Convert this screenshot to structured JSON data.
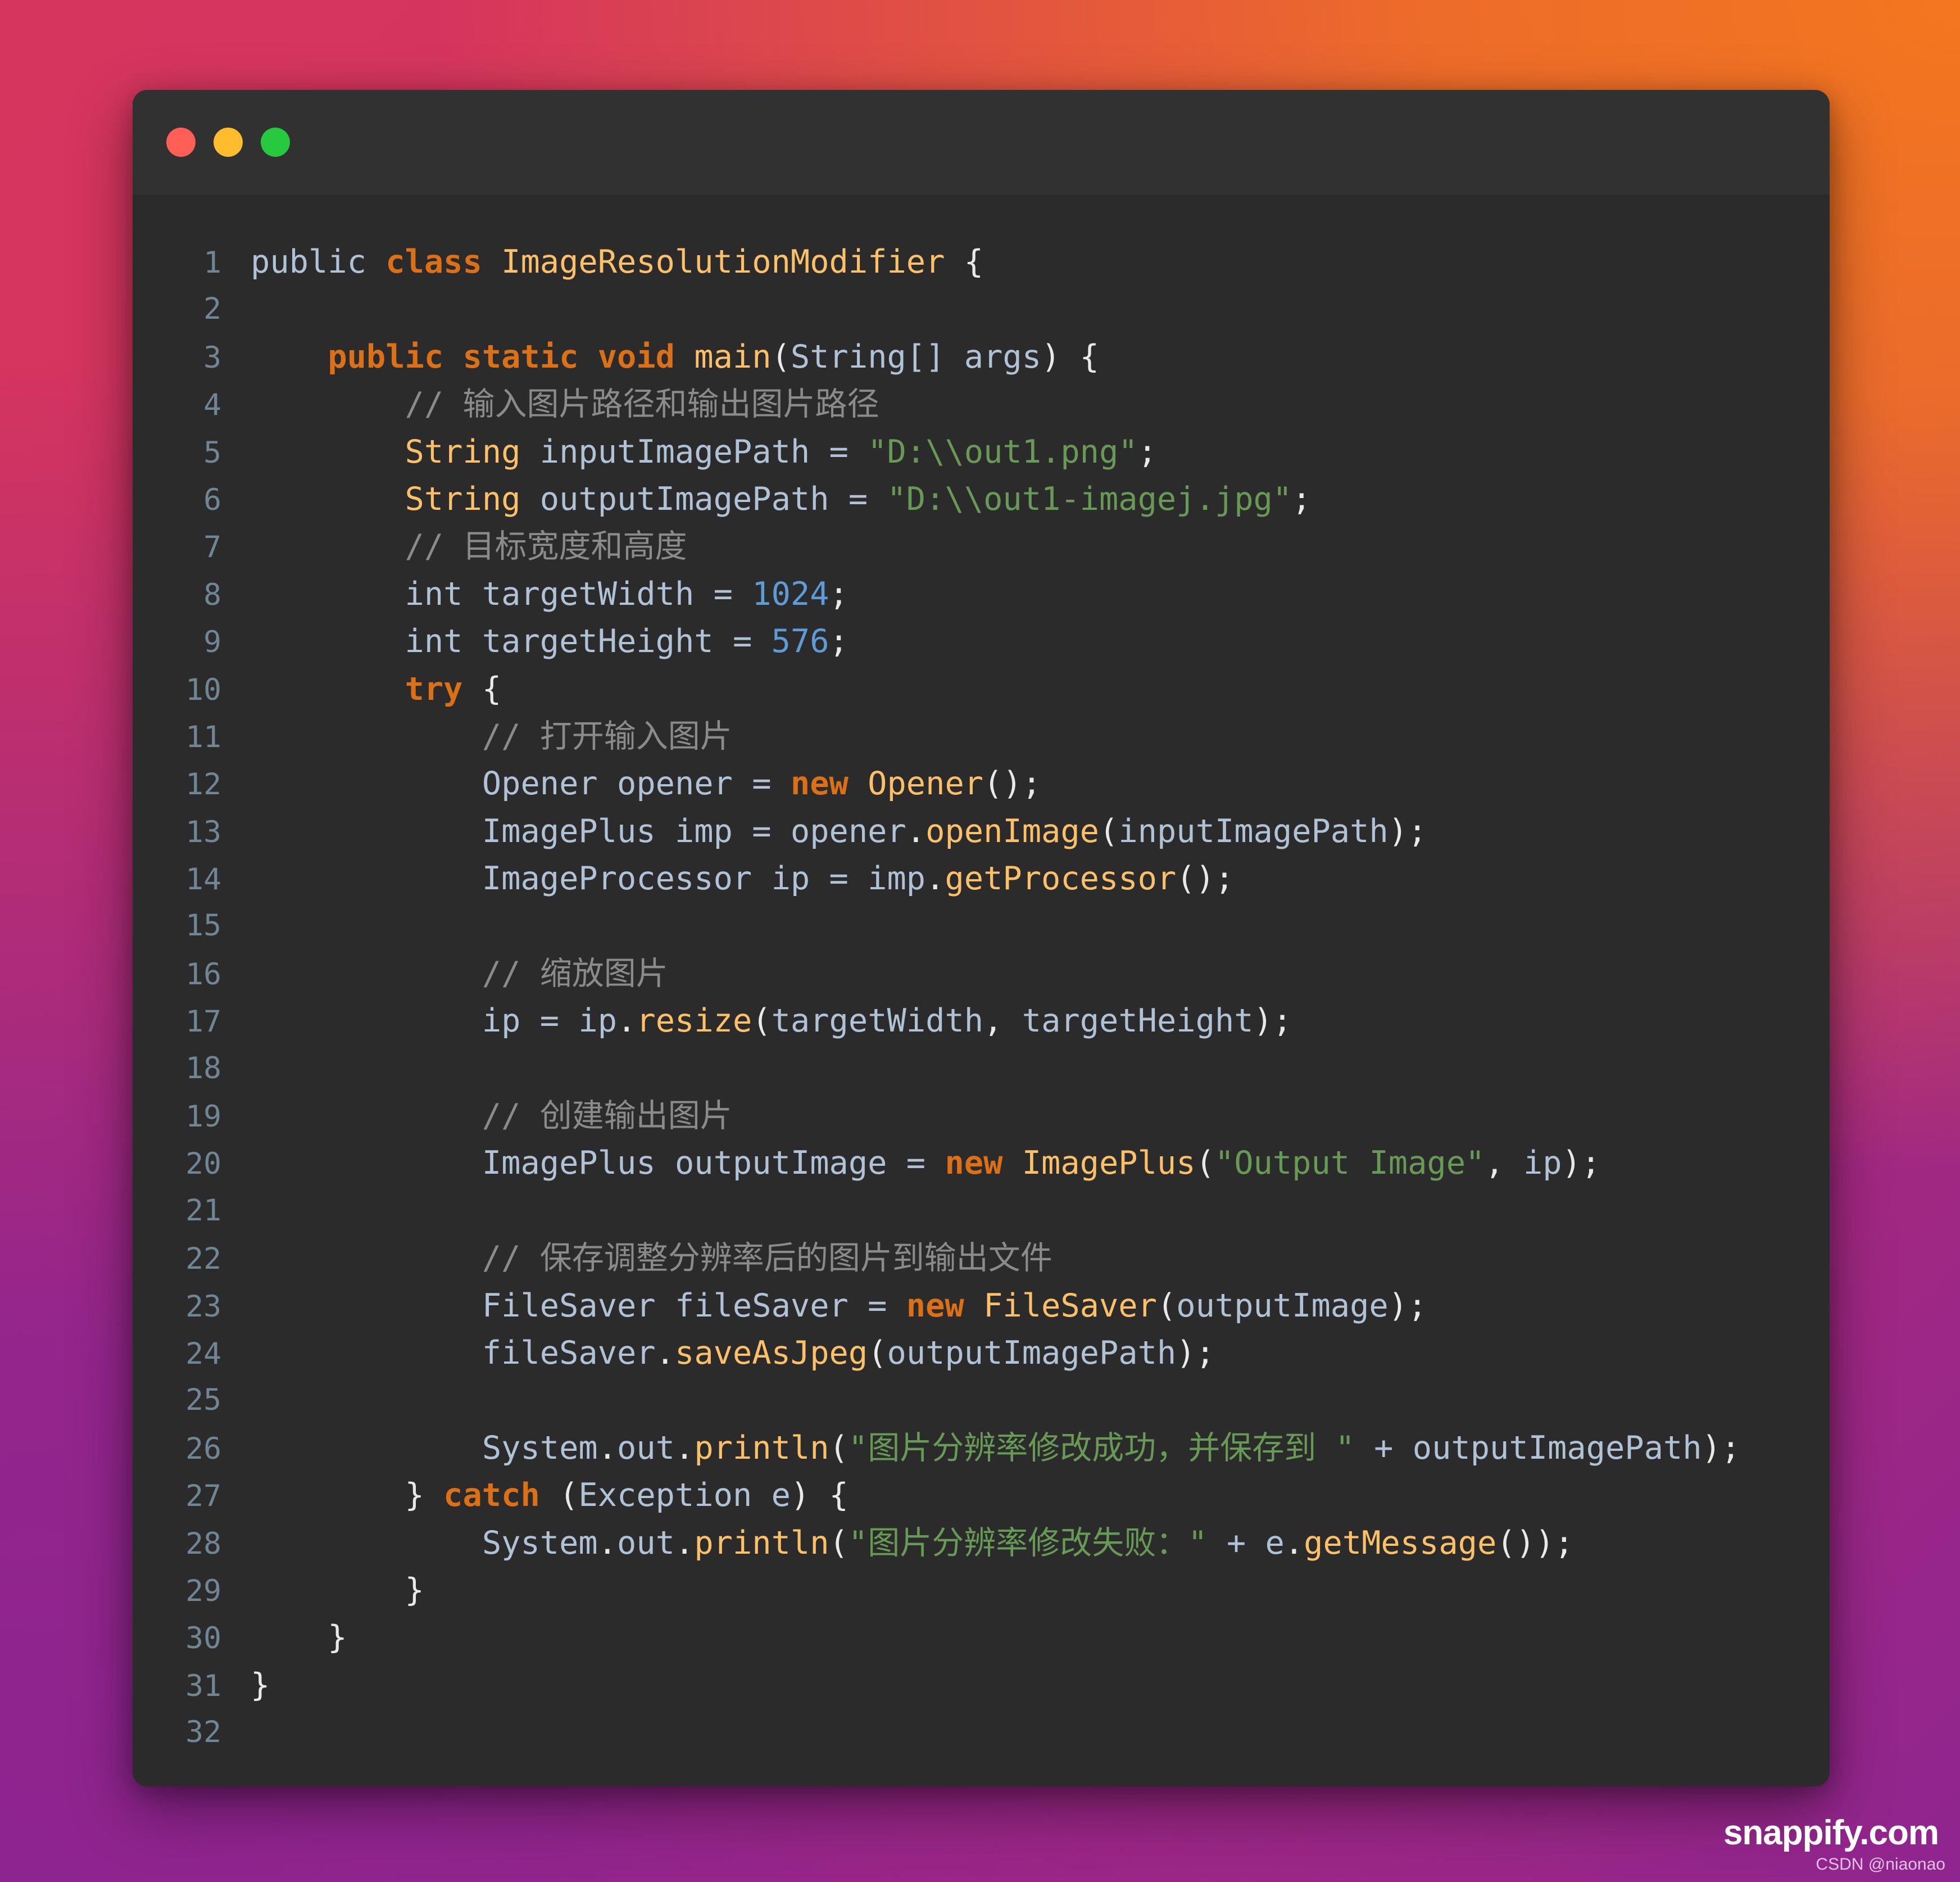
{
  "window": {
    "traffic_lights": [
      {
        "name": "close",
        "color": "#ff5f56"
      },
      {
        "name": "minimize",
        "color": "#ffbd2e"
      },
      {
        "name": "maximize",
        "color": "#27c93f"
      }
    ]
  },
  "editor": {
    "language": "java",
    "first_line_number": 1,
    "last_line_number": 32,
    "theme": {
      "background": "#2b2b2b",
      "titlebar": "#313131",
      "keyword": "#dc7017",
      "type": "#fcc069",
      "method": "#fcc069",
      "identifier": "#afc2d6",
      "string": "#669a55",
      "number": "#5e9cd8",
      "comment": "#8b8b8b",
      "punctuation": "#e9e9e9",
      "line_number": "#6f8694"
    },
    "lines": [
      {
        "n": 1,
        "tokens": [
          {
            "t": "public ",
            "c": "id"
          },
          {
            "t": "class ",
            "c": "kw"
          },
          {
            "t": "ImageResolutionModifier",
            "c": "typ"
          },
          {
            "t": " {",
            "c": "pun"
          }
        ]
      },
      {
        "n": 2,
        "tokens": []
      },
      {
        "n": 3,
        "tokens": [
          {
            "t": "    ",
            "c": "pun"
          },
          {
            "t": "public static void ",
            "c": "kw"
          },
          {
            "t": "main",
            "c": "typ"
          },
          {
            "t": "(",
            "c": "pun"
          },
          {
            "t": "String[] args",
            "c": "id"
          },
          {
            "t": ") {",
            "c": "pun"
          }
        ]
      },
      {
        "n": 4,
        "tokens": [
          {
            "t": "        // 输入图片路径和输出图片路径",
            "c": "cmt"
          }
        ]
      },
      {
        "n": 5,
        "tokens": [
          {
            "t": "        ",
            "c": "pun"
          },
          {
            "t": "String",
            "c": "typ"
          },
          {
            "t": " inputImagePath ",
            "c": "id"
          },
          {
            "t": "= ",
            "c": "id"
          },
          {
            "t": "\"D:\\\\out1.png\"",
            "c": "str"
          },
          {
            "t": ";",
            "c": "pun"
          }
        ]
      },
      {
        "n": 6,
        "tokens": [
          {
            "t": "        ",
            "c": "pun"
          },
          {
            "t": "String",
            "c": "typ"
          },
          {
            "t": " outputImagePath ",
            "c": "id"
          },
          {
            "t": "= ",
            "c": "id"
          },
          {
            "t": "\"D:\\\\out1-imagej.jpg\"",
            "c": "str"
          },
          {
            "t": ";",
            "c": "pun"
          }
        ]
      },
      {
        "n": 7,
        "tokens": [
          {
            "t": "        // 目标宽度和高度",
            "c": "cmt"
          }
        ]
      },
      {
        "n": 8,
        "tokens": [
          {
            "t": "        ",
            "c": "pun"
          },
          {
            "t": "int targetWidth ",
            "c": "id"
          },
          {
            "t": "= ",
            "c": "id"
          },
          {
            "t": "1024",
            "c": "num"
          },
          {
            "t": ";",
            "c": "pun"
          }
        ]
      },
      {
        "n": 9,
        "tokens": [
          {
            "t": "        ",
            "c": "pun"
          },
          {
            "t": "int targetHeight ",
            "c": "id"
          },
          {
            "t": "= ",
            "c": "id"
          },
          {
            "t": "576",
            "c": "num"
          },
          {
            "t": ";",
            "c": "pun"
          }
        ]
      },
      {
        "n": 10,
        "tokens": [
          {
            "t": "        ",
            "c": "pun"
          },
          {
            "t": "try",
            "c": "kw"
          },
          {
            "t": " {",
            "c": "pun"
          }
        ]
      },
      {
        "n": 11,
        "tokens": [
          {
            "t": "            // 打开输入图片",
            "c": "cmt"
          }
        ]
      },
      {
        "n": 12,
        "tokens": [
          {
            "t": "            ",
            "c": "pun"
          },
          {
            "t": "Opener opener ",
            "c": "id"
          },
          {
            "t": "= ",
            "c": "id"
          },
          {
            "t": "new ",
            "c": "kw"
          },
          {
            "t": "Opener",
            "c": "typ"
          },
          {
            "t": "();",
            "c": "pun"
          }
        ]
      },
      {
        "n": 13,
        "tokens": [
          {
            "t": "            ",
            "c": "pun"
          },
          {
            "t": "ImagePlus imp ",
            "c": "id"
          },
          {
            "t": "= ",
            "c": "id"
          },
          {
            "t": "opener",
            "c": "id"
          },
          {
            "t": ".",
            "c": "pun"
          },
          {
            "t": "openImage",
            "c": "mth"
          },
          {
            "t": "(",
            "c": "pun"
          },
          {
            "t": "inputImagePath",
            "c": "id"
          },
          {
            "t": ");",
            "c": "pun"
          }
        ]
      },
      {
        "n": 14,
        "tokens": [
          {
            "t": "            ",
            "c": "pun"
          },
          {
            "t": "ImageProcessor ip ",
            "c": "id"
          },
          {
            "t": "= ",
            "c": "id"
          },
          {
            "t": "imp",
            "c": "id"
          },
          {
            "t": ".",
            "c": "pun"
          },
          {
            "t": "getProcessor",
            "c": "mth"
          },
          {
            "t": "();",
            "c": "pun"
          }
        ]
      },
      {
        "n": 15,
        "tokens": []
      },
      {
        "n": 16,
        "tokens": [
          {
            "t": "            // 缩放图片",
            "c": "cmt"
          }
        ]
      },
      {
        "n": 17,
        "tokens": [
          {
            "t": "            ",
            "c": "pun"
          },
          {
            "t": "ip ",
            "c": "id"
          },
          {
            "t": "= ",
            "c": "id"
          },
          {
            "t": "ip",
            "c": "id"
          },
          {
            "t": ".",
            "c": "pun"
          },
          {
            "t": "resize",
            "c": "mth"
          },
          {
            "t": "(",
            "c": "pun"
          },
          {
            "t": "targetWidth",
            "c": "id"
          },
          {
            "t": ", ",
            "c": "pun"
          },
          {
            "t": "targetHeight",
            "c": "id"
          },
          {
            "t": ");",
            "c": "pun"
          }
        ]
      },
      {
        "n": 18,
        "tokens": []
      },
      {
        "n": 19,
        "tokens": [
          {
            "t": "            // 创建输出图片",
            "c": "cmt"
          }
        ]
      },
      {
        "n": 20,
        "tokens": [
          {
            "t": "            ",
            "c": "pun"
          },
          {
            "t": "ImagePlus outputImage ",
            "c": "id"
          },
          {
            "t": "= ",
            "c": "id"
          },
          {
            "t": "new ",
            "c": "kw"
          },
          {
            "t": "ImagePlus",
            "c": "typ"
          },
          {
            "t": "(",
            "c": "pun"
          },
          {
            "t": "\"Output Image\"",
            "c": "str"
          },
          {
            "t": ", ",
            "c": "pun"
          },
          {
            "t": "ip",
            "c": "id"
          },
          {
            "t": ");",
            "c": "pun"
          }
        ]
      },
      {
        "n": 21,
        "tokens": []
      },
      {
        "n": 22,
        "tokens": [
          {
            "t": "            // 保存调整分辨率后的图片到输出文件",
            "c": "cmt"
          }
        ]
      },
      {
        "n": 23,
        "tokens": [
          {
            "t": "            ",
            "c": "pun"
          },
          {
            "t": "FileSaver fileSaver ",
            "c": "id"
          },
          {
            "t": "= ",
            "c": "id"
          },
          {
            "t": "new ",
            "c": "kw"
          },
          {
            "t": "FileSaver",
            "c": "typ"
          },
          {
            "t": "(",
            "c": "pun"
          },
          {
            "t": "outputImage",
            "c": "id"
          },
          {
            "t": ");",
            "c": "pun"
          }
        ]
      },
      {
        "n": 24,
        "tokens": [
          {
            "t": "            ",
            "c": "pun"
          },
          {
            "t": "fileSaver",
            "c": "id"
          },
          {
            "t": ".",
            "c": "pun"
          },
          {
            "t": "saveAsJpeg",
            "c": "mth"
          },
          {
            "t": "(",
            "c": "pun"
          },
          {
            "t": "outputImagePath",
            "c": "id"
          },
          {
            "t": ");",
            "c": "pun"
          }
        ]
      },
      {
        "n": 25,
        "tokens": []
      },
      {
        "n": 26,
        "tokens": [
          {
            "t": "            ",
            "c": "pun"
          },
          {
            "t": "System",
            "c": "id"
          },
          {
            "t": ".",
            "c": "pun"
          },
          {
            "t": "out",
            "c": "id"
          },
          {
            "t": ".",
            "c": "pun"
          },
          {
            "t": "println",
            "c": "mth"
          },
          {
            "t": "(",
            "c": "pun"
          },
          {
            "t": "\"图片分辨率修改成功，并保存到 \"",
            "c": "str"
          },
          {
            "t": " + ",
            "c": "id"
          },
          {
            "t": "outputImagePath",
            "c": "id"
          },
          {
            "t": ");",
            "c": "pun"
          }
        ]
      },
      {
        "n": 27,
        "tokens": [
          {
            "t": "        } ",
            "c": "pun"
          },
          {
            "t": "catch",
            "c": "kw"
          },
          {
            "t": " (",
            "c": "pun"
          },
          {
            "t": "Exception e",
            "c": "id"
          },
          {
            "t": ") {",
            "c": "pun"
          }
        ]
      },
      {
        "n": 28,
        "tokens": [
          {
            "t": "            ",
            "c": "pun"
          },
          {
            "t": "System",
            "c": "id"
          },
          {
            "t": ".",
            "c": "pun"
          },
          {
            "t": "out",
            "c": "id"
          },
          {
            "t": ".",
            "c": "pun"
          },
          {
            "t": "println",
            "c": "mth"
          },
          {
            "t": "(",
            "c": "pun"
          },
          {
            "t": "\"图片分辨率修改失败：\"",
            "c": "str"
          },
          {
            "t": " + ",
            "c": "id"
          },
          {
            "t": "e",
            "c": "id"
          },
          {
            "t": ".",
            "c": "pun"
          },
          {
            "t": "getMessage",
            "c": "mth"
          },
          {
            "t": "());",
            "c": "pun"
          }
        ]
      },
      {
        "n": 29,
        "tokens": [
          {
            "t": "        }",
            "c": "pun"
          }
        ]
      },
      {
        "n": 30,
        "tokens": [
          {
            "t": "    }",
            "c": "pun"
          }
        ]
      },
      {
        "n": 31,
        "tokens": [
          {
            "t": "}",
            "c": "pun"
          }
        ]
      },
      {
        "n": 32,
        "tokens": []
      }
    ]
  },
  "watermarks": {
    "primary": "snappify.com",
    "secondary": "CSDN @niaonao"
  }
}
